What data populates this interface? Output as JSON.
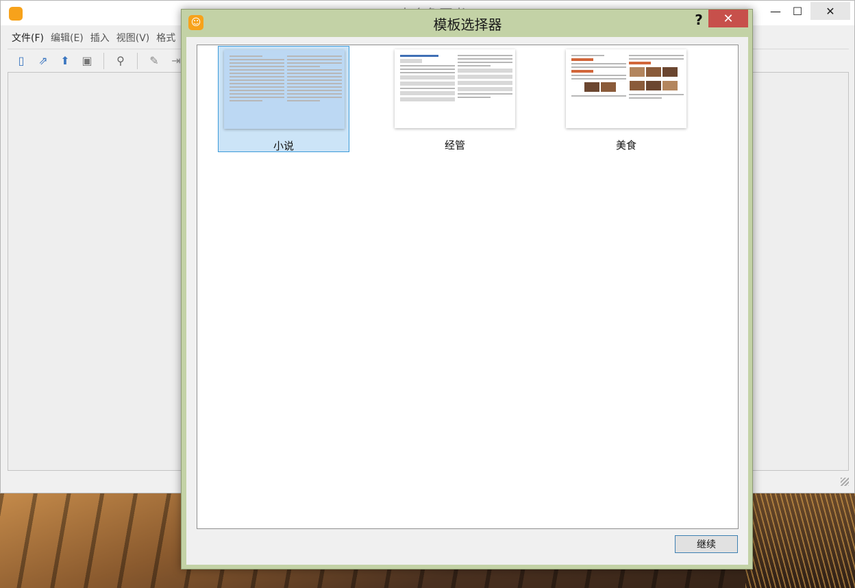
{
  "app": {
    "title": "大合象图书",
    "menu": [
      "文件(F)",
      "编辑(E)",
      "插入",
      "视图(V)",
      "格式"
    ],
    "toolbar_icons": [
      "new-icon",
      "open-icon",
      "upload-icon",
      "save-icon",
      "search-icon",
      "edit-icon",
      "import-icon"
    ],
    "window_controls": {
      "minimize": "—",
      "maximize": "☐",
      "close": "✕"
    }
  },
  "dialog": {
    "title": "模板选择器",
    "help": "?",
    "close": "✕",
    "templates": [
      {
        "label": "小说",
        "selected": true
      },
      {
        "label": "经管",
        "selected": false
      },
      {
        "label": "美食",
        "selected": false
      }
    ],
    "continue_label": "继续"
  },
  "colors": {
    "dialog_frame": "#c3d2a6",
    "close_button": "#c7504b",
    "selection_bg": "#cce4f7",
    "selection_border": "#3b9ad9",
    "accent_icon": "#f7a21b"
  }
}
